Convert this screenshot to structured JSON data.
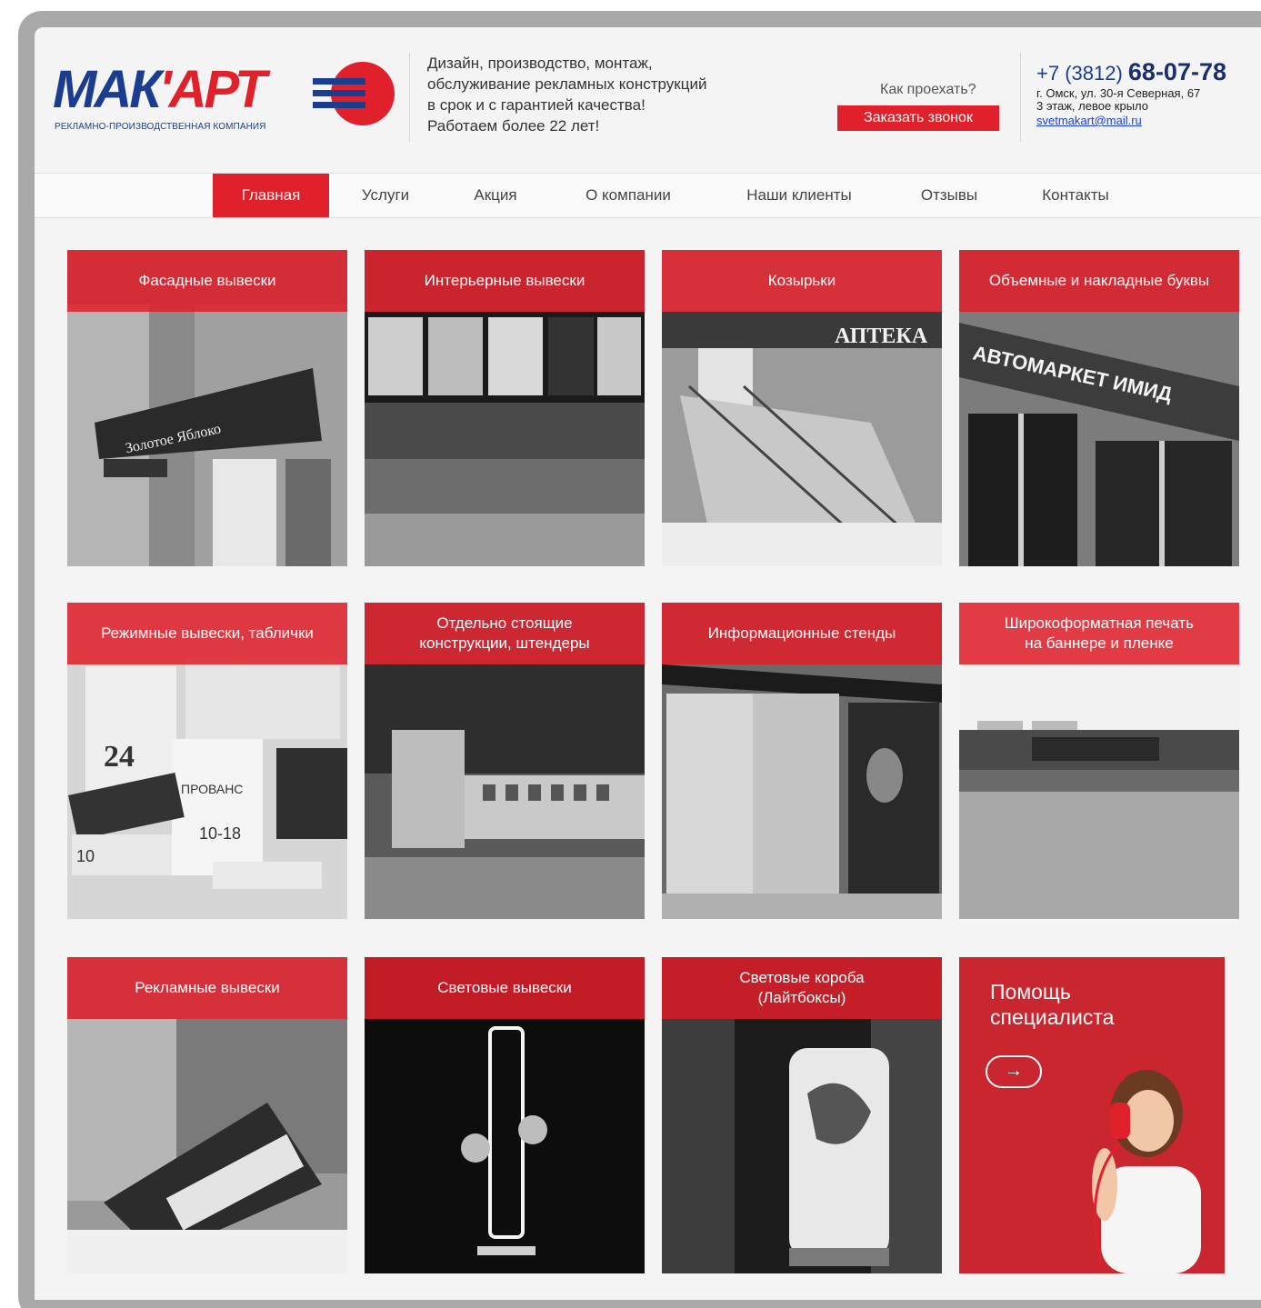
{
  "header": {
    "logo": {
      "word_part1": "МАК",
      "word_part2": "'АРТ",
      "subtitle": "РЕКЛАМНО-ПРОИЗВОДСТВЕННАЯ КОМПАНИЯ"
    },
    "tagline": "Дизайн, производство, монтаж,\nобслуживание рекламных конструкций\nв срок и с гарантией качества!\nРаботаем более 22 лет!",
    "route_link": "Как проехать?",
    "callback_button": "Заказать звонок",
    "phone_prefix": "+7 (3812) ",
    "phone_number": "68-07-78",
    "address_line1": "г. Омск, ул. 30-я Северная, 67",
    "address_line2": "3 этаж, левое крыло",
    "email": "svetmakart@mail.ru"
  },
  "nav": {
    "items": [
      "Главная",
      "Услуги",
      "Акция",
      "О компании",
      "Наши клиенты",
      "Отзывы",
      "Контакты"
    ],
    "active": "Главная"
  },
  "tiles": [
    {
      "label": "Фасадные вывески"
    },
    {
      "label": "Интерьерные вывески"
    },
    {
      "label": "Козырьки"
    },
    {
      "label": "Объемные и накладные буквы"
    },
    {
      "label": "Режимные вывески, таблички"
    },
    {
      "label": "Отдельно стоящие\nконструкции, штендеры"
    },
    {
      "label": "Информационные стенды"
    },
    {
      "label": "Широкоформатная печать\nна баннере и пленке"
    },
    {
      "label": "Рекламные вывески"
    },
    {
      "label": "Световые вывески"
    },
    {
      "label": "Световые короба\n(Лайтбоксы)"
    }
  ],
  "help": {
    "title": "Помощь\nспециалиста",
    "arrow": "→"
  },
  "colors": {
    "accent": "#e0202a",
    "brand_blue": "#1b3d8f"
  }
}
